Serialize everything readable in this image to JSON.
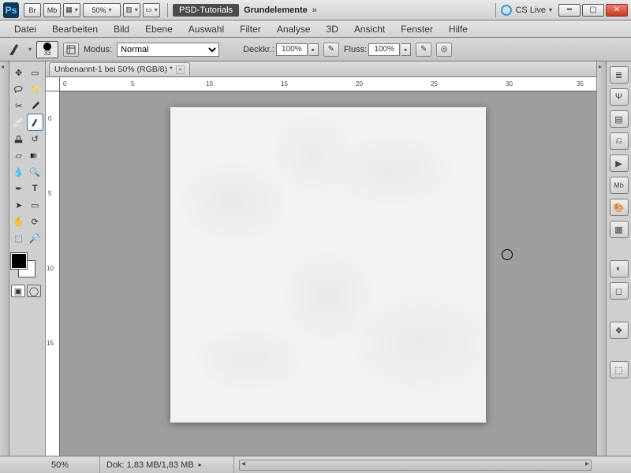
{
  "app": {
    "logo": "Ps",
    "buttons": [
      "Br",
      "Mb"
    ],
    "zoom_select": "50%",
    "workspace_active": "PSD-Tutorials",
    "workspace_other": "Grundelemente",
    "cs_live": "CS Live"
  },
  "menu": [
    "Datei",
    "Bearbeiten",
    "Bild",
    "Ebene",
    "Auswahl",
    "Filter",
    "Analyse",
    "3D",
    "Ansicht",
    "Fenster",
    "Hilfe"
  ],
  "options": {
    "brush_size": "33",
    "mode_label": "Modus:",
    "mode_value": "Normal",
    "opacity_label": "Deckkr.:",
    "opacity_value": "100%",
    "flow_label": "Fluss:",
    "flow_value": "100%"
  },
  "document": {
    "tab_title": "Unbenannt-1 bei 50% (RGB/8) *",
    "hruler": [
      "0",
      "5",
      "10",
      "15",
      "20",
      "25",
      "30",
      "35"
    ],
    "vruler": [
      "0",
      "5",
      "10",
      "15"
    ]
  },
  "status": {
    "zoom": "50%",
    "doc_info": "Dok: 1,83 MB/1,83 MB"
  },
  "tools": {
    "left": [
      [
        "move",
        "marquee"
      ],
      [
        "lasso",
        "magic-wand"
      ],
      [
        "crop",
        "eyedropper"
      ],
      [
        "healing-brush",
        "brush"
      ],
      [
        "clone-stamp",
        "history-brush"
      ],
      [
        "eraser",
        "gradient"
      ],
      [
        "blur",
        "dodge"
      ],
      [
        "pen",
        "type"
      ],
      [
        "path-select",
        "rectangle"
      ],
      [
        "hand",
        "rotate-view"
      ],
      [
        "zoom",
        "zoom-out"
      ]
    ],
    "active": "brush"
  },
  "dock_icons": [
    "history",
    "character",
    "brushes",
    "clone-source",
    "actions",
    "mini-bridge",
    "swatches",
    "color",
    "channels",
    "layers",
    "paths",
    "layer-comps",
    "adjustments",
    "masks"
  ]
}
